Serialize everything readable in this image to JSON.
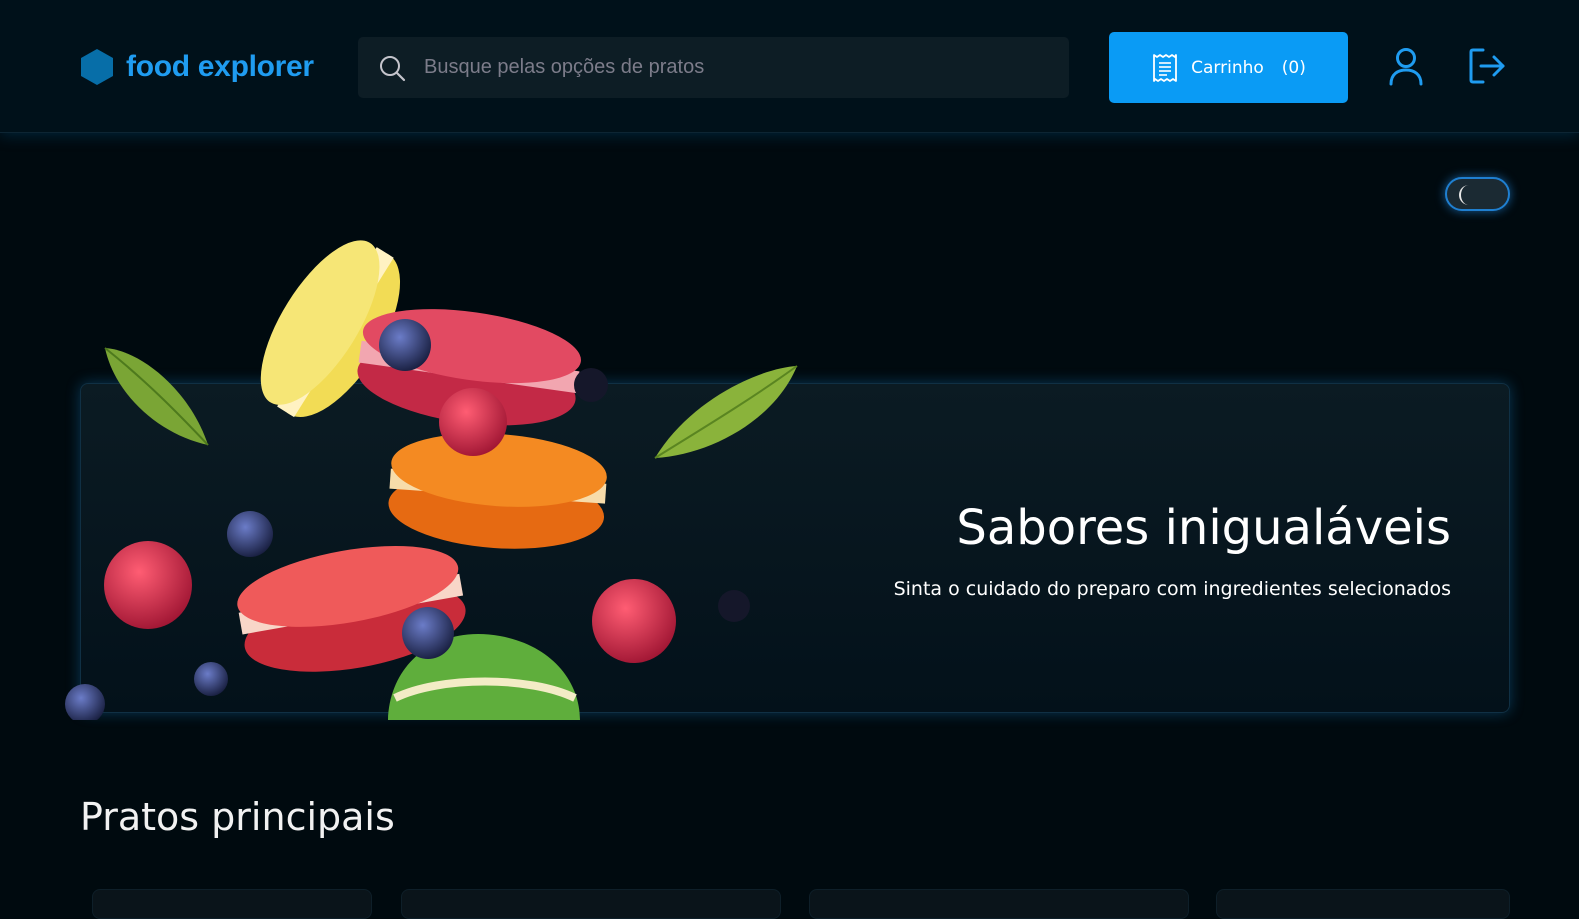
{
  "header": {
    "brand": "food explorer",
    "search_placeholder": "Busque pelas opções de pratos",
    "cart_label": "Carrinho",
    "cart_count": "(0)"
  },
  "banner": {
    "title": "Sabores inigualáveis",
    "subtitle": "Sinta o cuidado do preparo com ingredientes selecionados"
  },
  "sections": [
    {
      "title": "Pratos principais"
    }
  ],
  "theme_toggle": {
    "mode": "dark"
  },
  "colors": {
    "background": "#000a0f",
    "header": "#00111a",
    "accent": "#0a9bf5",
    "brand": "#1f9cf0"
  },
  "icons": {
    "logo": "hexagon-icon",
    "search": "search-icon",
    "cart": "receipt-icon",
    "profile": "user-icon",
    "logout": "sign-out-icon",
    "theme": "moon-icon"
  }
}
